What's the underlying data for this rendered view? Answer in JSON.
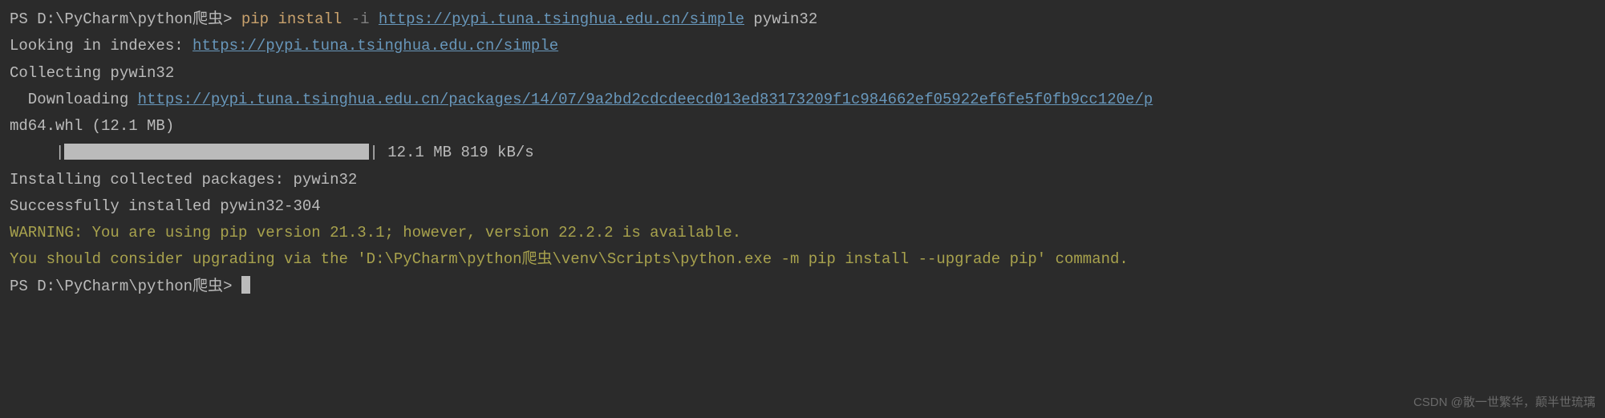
{
  "line1": {
    "prompt_prefix": "PS ",
    "prompt_path": "D:\\PyCharm\\python爬虫",
    "prompt_symbol": "> ",
    "cmd1": "pip ",
    "cmd2": "install ",
    "flag": "-i ",
    "url": "https://pypi.tuna.tsinghua.edu.cn/simple",
    "pkg": " pywin32"
  },
  "line2": {
    "prefix": "Looking in indexes: ",
    "url": "https://pypi.tuna.tsinghua.edu.cn/simple"
  },
  "line3": {
    "text": "Collecting pywin32"
  },
  "line4": {
    "prefix": "  Downloading ",
    "url": "https://pypi.tuna.tsinghua.edu.cn/packages/14/07/9a2bd2cdcdeecd013ed83173209f1c984662ef05922ef6fe5f0fb9cc120e/p"
  },
  "line5": {
    "text": "md64.whl (12.1 MB)"
  },
  "line6": {
    "prefix": "     |",
    "suffix": "| 12.1 MB 819 kB/s"
  },
  "line7": {
    "text": "Installing collected packages: pywin32"
  },
  "line8": {
    "text": "Successfully installed pywin32-304"
  },
  "line9": {
    "text": "WARNING: You are using pip version 21.3.1; however, version 22.2.2 is available."
  },
  "line10": {
    "text": "You should consider upgrading via the 'D:\\PyCharm\\python爬虫\\venv\\Scripts\\python.exe -m pip install --upgrade pip' command."
  },
  "line11": {
    "prompt_prefix": "PS ",
    "prompt_path": "D:\\PyCharm\\python爬虫",
    "prompt_symbol": "> "
  },
  "watermark": "CSDN @散一世繁华，颠半世琉璃"
}
